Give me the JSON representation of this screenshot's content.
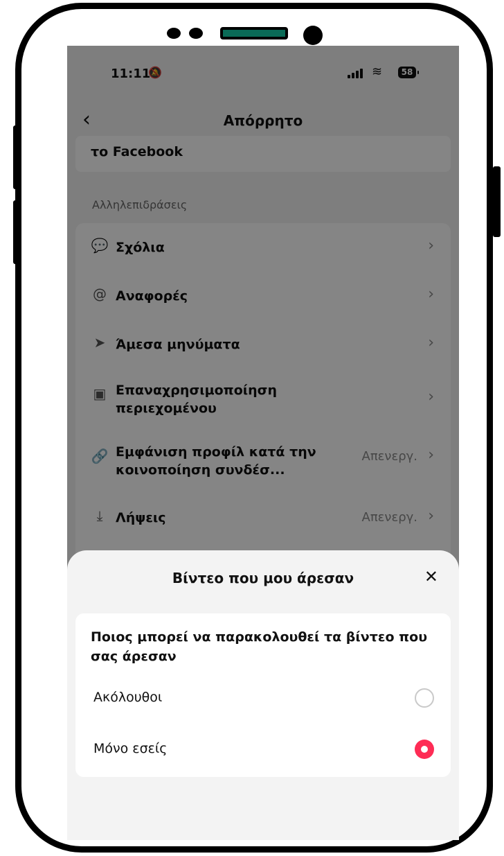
{
  "status_bar": {
    "time": "11:11",
    "battery": "58"
  },
  "nav": {
    "title": "Απόρρητο",
    "back_icon": "chevron-left-icon"
  },
  "top_card": {
    "text": "το Facebook"
  },
  "section_header": "Αλληλεπιδράσεις",
  "interactions": [
    {
      "icon": "comment-bubble-icon",
      "label": "Σχόλια",
      "value": ""
    },
    {
      "icon": "at-mention-icon",
      "label": "Αναφορές",
      "value": ""
    },
    {
      "icon": "send-arrow-icon",
      "label": "Άμεσα μηνύματα",
      "value": ""
    },
    {
      "icon": "video-reuse-icon",
      "label": "Επαναχρησιμοποίηση περιεχομένου",
      "value": ""
    },
    {
      "icon": "link-icon",
      "label": "Εμφάνιση προφίλ κατά την κοινοποίηση συνδέσ...",
      "value": "Απενεργ."
    },
    {
      "icon": "download-icon",
      "label": "Λήψεις",
      "value": "Απενεργ."
    }
  ],
  "sheet": {
    "title": "Βίντεο που μου άρεσαν",
    "close_icon": "close-icon",
    "question": "Ποιος μπορεί να παρακολουθεί τα βίντεο που σας άρεσαν",
    "options": [
      {
        "label": "Ακόλουθοι",
        "selected": false
      },
      {
        "label": "Μόνο εσείς",
        "selected": true
      }
    ]
  },
  "colors": {
    "accent": "#fe2c55",
    "overlay": "rgba(0,0,0,0.48)",
    "sheet_bg": "#f3f3f3"
  }
}
